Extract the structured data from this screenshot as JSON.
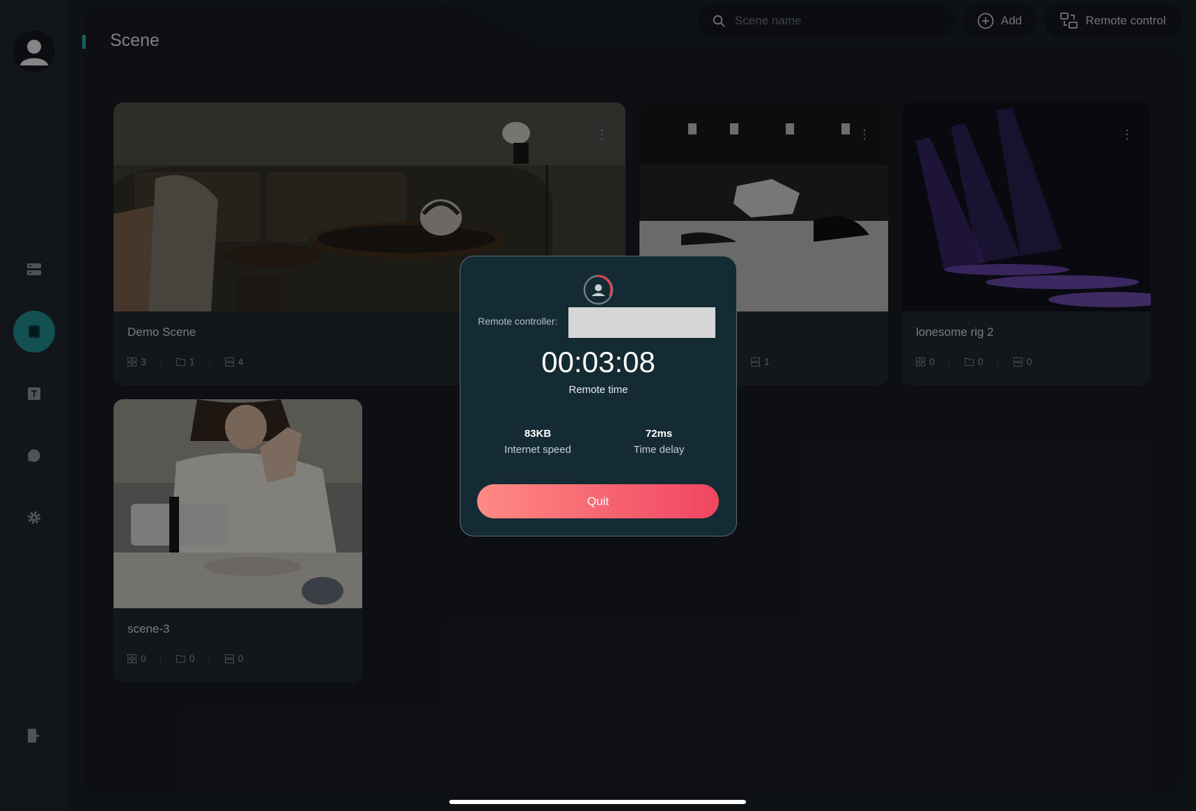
{
  "header": {
    "title": "Scene",
    "search_placeholder": "Scene name",
    "add_label": "Add",
    "remote_label": "Remote control"
  },
  "sidebar": {
    "items": [
      {
        "icon": "devices-icon"
      },
      {
        "icon": "scene-icon",
        "active": true
      },
      {
        "icon": "text-icon"
      },
      {
        "icon": "chat-icon"
      },
      {
        "icon": "gear-icon"
      }
    ],
    "logout_icon": "logout-icon"
  },
  "scenes": [
    {
      "name": "Demo Scene",
      "counts": [
        "3",
        "1",
        "4"
      ]
    },
    {
      "name": "",
      "counts": [
        "1"
      ]
    },
    {
      "name": "lonesome rig 2",
      "counts": [
        "0",
        "0",
        "0"
      ]
    },
    {
      "name": "scene-3",
      "counts": [
        "0",
        "0",
        "0"
      ]
    }
  ],
  "modal": {
    "controller_label": "Remote controller:",
    "time": "00:03:08",
    "time_label": "Remote time",
    "speed_value": "83KB",
    "speed_label": "Internet speed",
    "delay_value": "72ms",
    "delay_label": "Time delay",
    "quit_label": "Quit"
  }
}
